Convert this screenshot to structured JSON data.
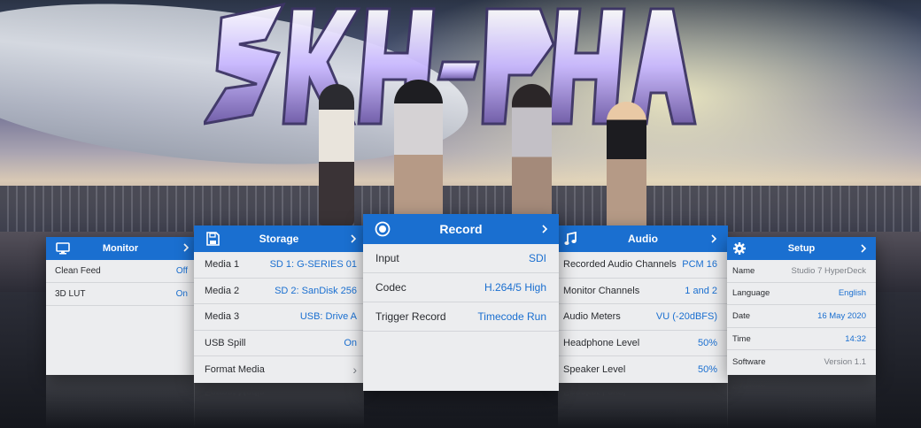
{
  "hero": {
    "logo_text": "SKY-PHASE"
  },
  "panels": {
    "monitor": {
      "title": "Monitor",
      "icon": "monitor-icon",
      "rows": [
        {
          "label": "Clean Feed",
          "value": "Off"
        },
        {
          "label": "3D LUT",
          "value": "On"
        }
      ]
    },
    "storage": {
      "title": "Storage",
      "icon": "floppy-disk-icon",
      "rows": [
        {
          "label": "Media 1",
          "value": "SD 1: G-SERIES 01"
        },
        {
          "label": "Media 2",
          "value": "SD 2: SanDisk 256"
        },
        {
          "label": "Media 3",
          "value": "USB: Drive A"
        },
        {
          "label": "USB Spill",
          "value": "On"
        },
        {
          "label": "Format Media",
          "value": "›"
        }
      ]
    },
    "record": {
      "title": "Record",
      "icon": "record-icon",
      "rows": [
        {
          "label": "Input",
          "value": "SDI"
        },
        {
          "label": "Codec",
          "value": "H.264/5 High"
        },
        {
          "label": "Trigger Record",
          "value": "Timecode Run"
        }
      ]
    },
    "audio": {
      "title": "Audio",
      "icon": "music-note-icon",
      "rows": [
        {
          "label": "Recorded Audio Channels",
          "value": "PCM 16"
        },
        {
          "label": "Monitor Channels",
          "value": "1 and 2"
        },
        {
          "label": "Audio Meters",
          "value": "VU (-20dBFS)"
        },
        {
          "label": "Headphone Level",
          "value": "50%"
        },
        {
          "label": "Speaker Level",
          "value": "50%"
        }
      ]
    },
    "setup": {
      "title": "Setup",
      "icon": "gear-icon",
      "rows": [
        {
          "label": "Name",
          "value": "Studio 7 HyperDeck"
        },
        {
          "label": "Language",
          "value": "English"
        },
        {
          "label": "Date",
          "value": "16 May 2020"
        },
        {
          "label": "Time",
          "value": "14:32"
        },
        {
          "label": "Software",
          "value": "Version 1.1"
        }
      ]
    }
  },
  "colors": {
    "accent": "#1a6fd0",
    "panel_bg": "#ecedef",
    "value_grey": "#7b7f86"
  }
}
